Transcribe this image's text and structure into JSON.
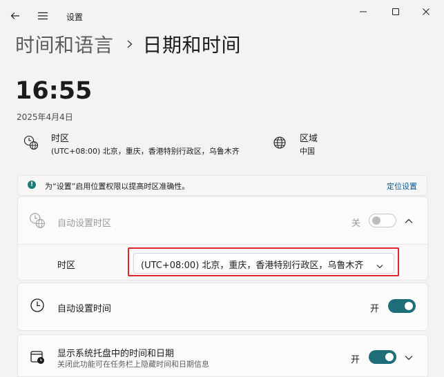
{
  "window": {
    "title": "设置",
    "back_icon": "back-arrow-icon",
    "menu_icon": "hamburger-menu-icon",
    "controls": [
      "minimize-icon",
      "maximize-icon",
      "close-icon"
    ]
  },
  "breadcrumb": {
    "parent": "时间和语言",
    "separator_icon": "chevron-right-icon",
    "current": "日期和时间"
  },
  "clock": {
    "time": "16:55",
    "date": "2025年4月4日"
  },
  "summary": {
    "timezone": {
      "icon": "timezone-globe-clock-icon",
      "title": "时区",
      "value": "(UTC+08:00) 北京，重庆，香港特别行政区，乌鲁木齐"
    },
    "region": {
      "icon": "globe-icon",
      "title": "区域",
      "value": "中国"
    }
  },
  "notice": {
    "icon": "info-icon",
    "text": "为“设置”启用位置权限以提高时区准确性。",
    "link": "定位设置"
  },
  "settings": {
    "auto_timezone": {
      "label": "自动设置时区",
      "state": "关",
      "on": false,
      "icon": "timezone-globe-clock-icon",
      "expander_icon": "chevron-up-icon"
    },
    "timezone_select": {
      "label": "时区",
      "value": "(UTC+08:00) 北京，重庆，香港特别行政区，乌鲁木齐",
      "dropdown_icon": "chevron-down-icon"
    },
    "auto_time": {
      "label": "自动设置时间",
      "state": "开",
      "on": true,
      "icon": "clock-icon"
    },
    "tray_time": {
      "label": "显示系统托盘中的时间和日期",
      "sub": "关闭此功能可在任务栏上隐藏时间和日期信息",
      "state": "开",
      "on": true,
      "icon": "calendar-clock-icon",
      "expander_icon": "chevron-down-icon"
    }
  },
  "colors": {
    "accent": "#1e6e79",
    "highlight": "#e0242a",
    "link": "#005a9e"
  }
}
